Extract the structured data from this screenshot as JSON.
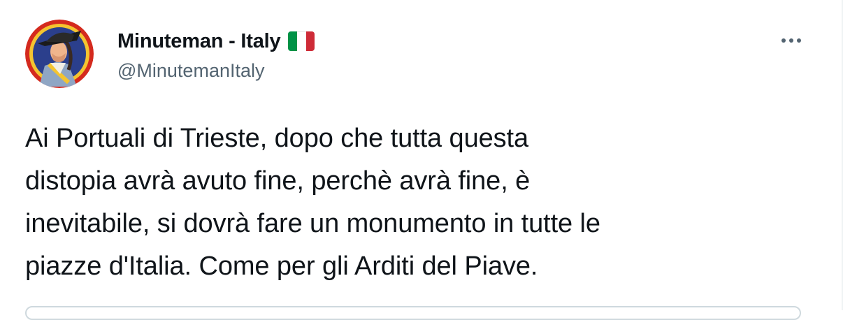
{
  "tweet": {
    "display_name": "Minuteman - Italy",
    "handle": "@MinutemanItaly",
    "flag": {
      "icon": "italy-flag-icon",
      "colors": [
        "#009246",
        "#ffffff",
        "#ce2b37"
      ]
    },
    "avatar_icon": "minuteman-avatar-icon",
    "more_icon": "more-options-icon",
    "text": "Ai Portuali di Trieste, dopo che tutta questa\ndistopia avrà avuto fine, perchè avrà fine, è\ninevitabile, si dovrà fare un monumento in tutte le\npiazze d'Italia. Come per gli Arditi del Piave."
  },
  "colors": {
    "text_primary": "#0f1419",
    "text_secondary": "#536471",
    "border": "#cfd9de"
  }
}
